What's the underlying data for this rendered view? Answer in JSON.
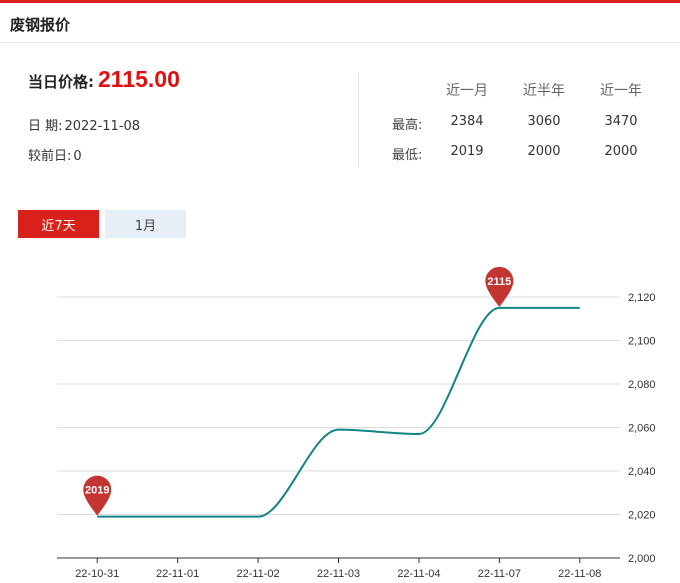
{
  "header": {
    "title": "废钢报价"
  },
  "today": {
    "label": "当日价格:",
    "price": "2115.00"
  },
  "info": {
    "date_label": "日 期:",
    "date_value": "2022-11-08",
    "change_label": "较前日:",
    "change_value": "0"
  },
  "stats": {
    "columns": [
      "近一月",
      "近半年",
      "近一年"
    ],
    "rows": [
      {
        "label": "最高:",
        "values": [
          "2384",
          "3060",
          "3470"
        ]
      },
      {
        "label": "最低:",
        "values": [
          "2019",
          "2000",
          "2000"
        ]
      }
    ]
  },
  "tabs": [
    {
      "label": "近7天",
      "active": true
    },
    {
      "label": "1月",
      "active": false
    }
  ],
  "colors": {
    "accent": "#d9211b",
    "line": "#138485",
    "pin": "#c23531"
  },
  "chart_data": {
    "type": "line",
    "categories": [
      "22-10-31",
      "22-11-01",
      "22-11-02",
      "22-11-03",
      "22-11-04",
      "22-11-07",
      "22-11-08"
    ],
    "series": [
      {
        "values": [
          2019,
          2019,
          2019,
          2059,
          2057,
          2115,
          2115
        ]
      }
    ],
    "ylim": [
      2000,
      2120
    ],
    "yticks": [
      "2,000",
      "2,020",
      "2,040",
      "2,060",
      "2,080",
      "2,100",
      "2,120"
    ],
    "markers": [
      {
        "label": "2019",
        "index": 0,
        "value": 2019
      },
      {
        "label": "2115",
        "index": 5,
        "value": 2115
      }
    ],
    "grid": true,
    "title": "",
    "xlabel": "",
    "ylabel": ""
  }
}
